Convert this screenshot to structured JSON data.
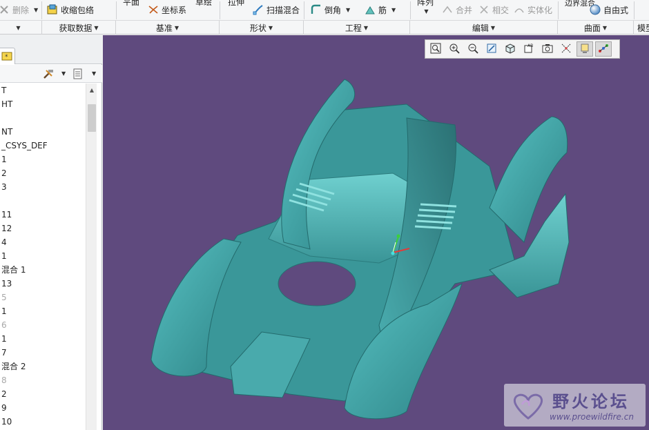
{
  "ribbon": {
    "delete_label": "删除",
    "shrinkwrap_label": "收缩包络",
    "plane_label": "平面",
    "csys_label": "坐标系",
    "sketch_label": "草绘",
    "extrude_label": "拉伸",
    "swept_blend_label": "扫描混合",
    "round_label": "倒角",
    "rib_label": "筋",
    "pattern_label": "阵列",
    "merge_label": "合并",
    "intersect_label": "相交",
    "solidify_label": "实体化",
    "boundary_blend_label": "边界混合",
    "freestyle_label": "自由式",
    "groups": [
      "获取数据",
      "基准",
      "形状",
      "工程",
      "编辑",
      "曲面",
      "模型"
    ]
  },
  "tree": {
    "items": [
      {
        "label": "T",
        "dim": false
      },
      {
        "label": "HT",
        "dim": false
      },
      {
        "label": "",
        "dim": false
      },
      {
        "label": "NT",
        "dim": false
      },
      {
        "label": "_CSYS_DEF",
        "dim": false
      },
      {
        "label": "1",
        "dim": false
      },
      {
        "label": "2",
        "dim": false
      },
      {
        "label": "3",
        "dim": false
      },
      {
        "label": "",
        "dim": false
      },
      {
        "label": "11",
        "dim": false
      },
      {
        "label": "12",
        "dim": false
      },
      {
        "label": "4",
        "dim": false
      },
      {
        "label": "1",
        "dim": false
      },
      {
        "label": "混合 1",
        "dim": false
      },
      {
        "label": "13",
        "dim": false
      },
      {
        "label": "5",
        "dim": true
      },
      {
        "label": "1",
        "dim": false
      },
      {
        "label": "6",
        "dim": true
      },
      {
        "label": "1",
        "dim": false
      },
      {
        "label": "7",
        "dim": false
      },
      {
        "label": "混合 2",
        "dim": false
      },
      {
        "label": "8",
        "dim": true
      },
      {
        "label": "2",
        "dim": false
      },
      {
        "label": "9",
        "dim": false
      },
      {
        "label": "10",
        "dim": false
      }
    ]
  },
  "watermark": {
    "title": "野火论坛",
    "url": "www.proewildfire.cn"
  },
  "colors": {
    "viewport_bg": "#5f4a7e",
    "model_fill": "#3e9c9f"
  }
}
